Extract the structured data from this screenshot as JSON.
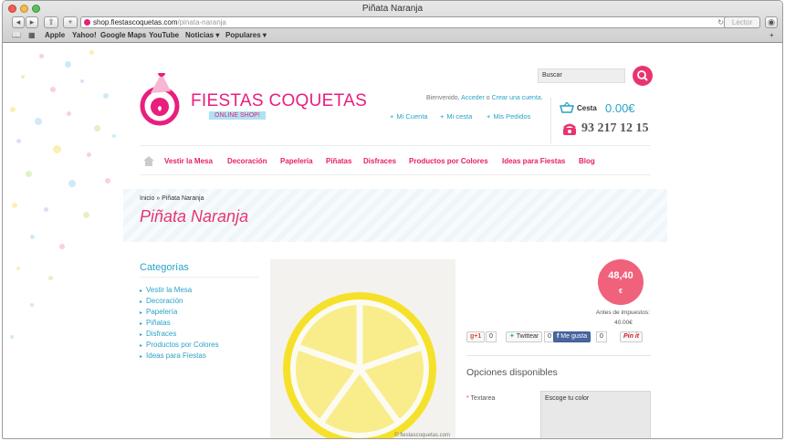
{
  "browser": {
    "title": "Piñata Naranja",
    "url_host": "shop.fiestascoquetas.com",
    "url_path": "/pinata-naranja",
    "reader_label": "Lector",
    "bookmarks": [
      "Apple",
      "Yahoo!",
      "Google Maps",
      "YouTube",
      "Noticias ▾",
      "Populares ▾"
    ]
  },
  "header": {
    "logo_text": "FIESTAS COQUETAS",
    "logo_sub": "ONLINE SHOP!",
    "search_placeholder": "Buscar",
    "welcome_text": "Bienvenido,",
    "login_link": "Acceder",
    "or_text": "o",
    "create_link": "Crear una cuenta.",
    "account_links": [
      "Mi Cuenta",
      "Mi cesta",
      "Mis Pedidos"
    ],
    "cart_label": "Cesta",
    "cart_total": "0.00€",
    "phone": "93 217 12 15"
  },
  "nav": {
    "items": [
      "Vestir la Mesa",
      "Decoración",
      "Papelería",
      "Piñatas",
      "Disfraces",
      "Productos por Colores",
      "Ideas para Fiestas",
      "Blog"
    ]
  },
  "breadcrumb": {
    "home": "Inicio",
    "separator": "»",
    "current": "Piñata Naranja"
  },
  "page_title": "Piñata Naranja",
  "sidebar": {
    "heading": "Categorías",
    "items": [
      "Vestir la Mesa",
      "Decoración",
      "Papelería",
      "Piñatas",
      "Disfraces",
      "Productos por Colores",
      "Ideas para Fiestas"
    ]
  },
  "product": {
    "watermark": "© fiestascoquetas.com",
    "price": "48,40",
    "currency": "€",
    "tax_label": "Antes de impuestos:",
    "tax_value": "40.00€",
    "social": {
      "gplus": "g+1",
      "gplus_count": "0",
      "tweet": "Twittear",
      "tweet_count": "0",
      "like": "Me gusta",
      "like_count": "0",
      "pin": "Pin it"
    },
    "options_heading": "Opciones disponibles",
    "option_label": "Textarea",
    "option_value": "Escoge tu color"
  },
  "colors": {
    "brand_pink": "#e8356f",
    "link_blue": "#29a3c7"
  }
}
